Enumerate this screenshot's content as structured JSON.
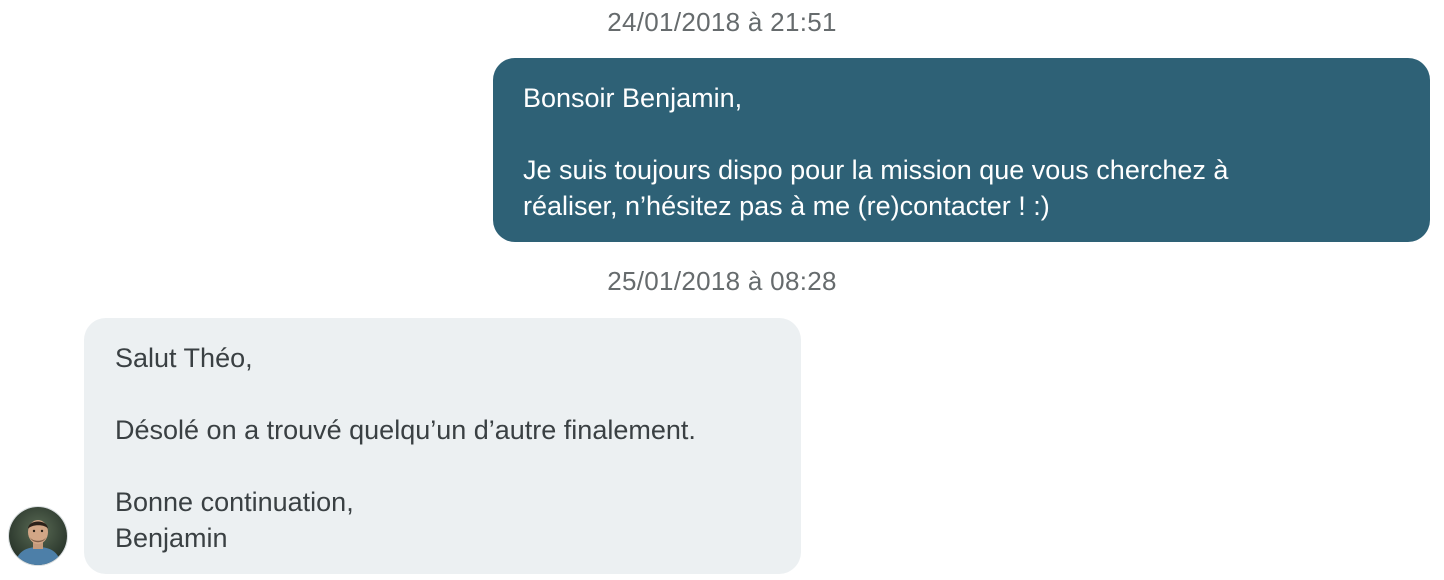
{
  "conversation": {
    "messages": [
      {
        "timestamp": "24/01/2018 à 21:51",
        "direction": "outgoing",
        "text": "Bonsoir Benjamin,\n\nJe suis toujours dispo pour la mission que vous cherchez à\nréaliser, n’hésitez pas à me (re)contacter ! :)"
      },
      {
        "timestamp": "25/01/2018 à 08:28",
        "direction": "incoming",
        "text": "Salut Théo,\n\nDésolé on a trouvé quelqu’un d’autre finalement.\n\nBonne continuation,\nBenjamin",
        "avatar_icon": "user-avatar-photo"
      }
    ]
  },
  "colors": {
    "outgoing_bubble": "#2e6176",
    "incoming_bubble": "#ecf0f2",
    "timestamp_text": "#666b6d",
    "incoming_text": "#3a4043",
    "outgoing_text": "#ffffff"
  }
}
